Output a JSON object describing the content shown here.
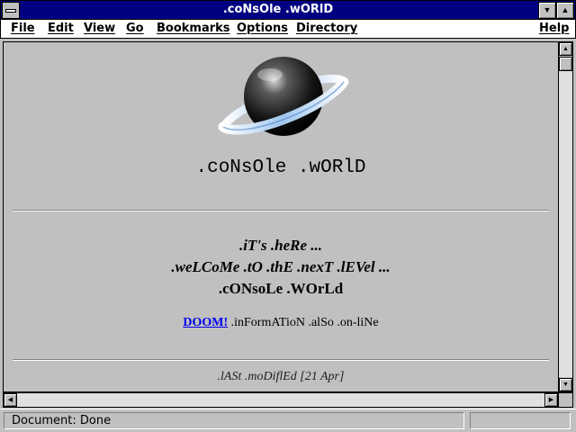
{
  "window": {
    "title": ".coNsOle .wORlD"
  },
  "menu": {
    "items": [
      "File",
      "Edit",
      "View",
      "Go",
      "Bookmarks",
      "Options",
      "Directory"
    ],
    "help": "Help"
  },
  "page": {
    "site_title": ".coNsOle .wORlD",
    "intro_1": ".iT's .heRe ...",
    "intro_2": ".weLCoMe .tO .thE .nexT .lEVel ...",
    "intro_3": ".cONsoLe .WOrLd",
    "doom_link": "DOOM!",
    "info_text": " .inFormATioN .alSo .on-liNe",
    "last_modified": ".lASt .moDiflEd [21 Apr]"
  },
  "status": {
    "text": "Document: Done"
  },
  "icons": {
    "system_menu": "system-menu-icon",
    "minimize": "minimize-icon",
    "maximize": "maximize-icon",
    "logo": "planet-logo"
  },
  "colors": {
    "titlebar": "#000080",
    "background": "#c0c0c0",
    "link": "#0000ee"
  }
}
